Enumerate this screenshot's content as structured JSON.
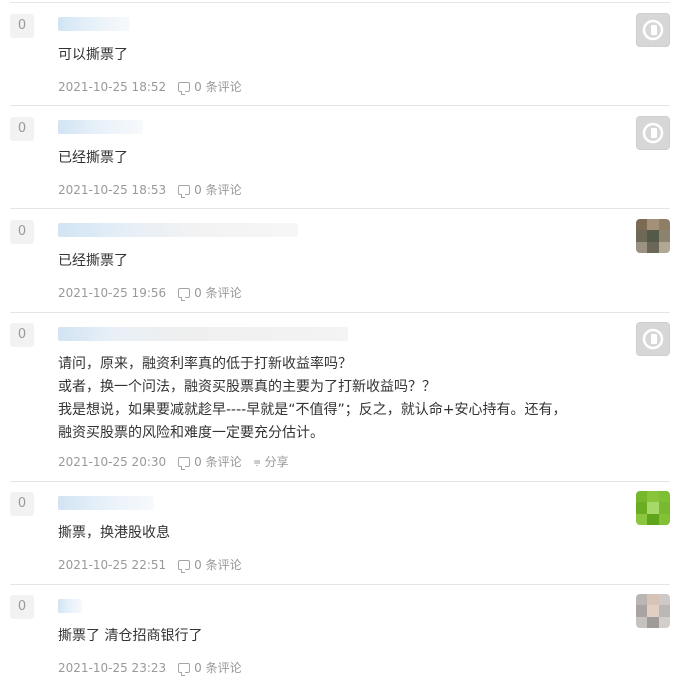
{
  "comments": [
    {
      "votes": "0",
      "text": [
        "可以撕票了"
      ],
      "time": "2021-10-25 18:52",
      "comments_label": "0 条评论",
      "avatar": "default-avatar-icon"
    },
    {
      "votes": "0",
      "text": [
        "已经撕票了"
      ],
      "time": "2021-10-25 18:53",
      "comments_label": "0 条评论",
      "avatar": "default-avatar-icon"
    },
    {
      "votes": "0",
      "text": [
        "已经撕票了"
      ],
      "time": "2021-10-25 19:56",
      "comments_label": "0 条评论",
      "avatar": "pixelated-avatar-brown"
    },
    {
      "votes": "0",
      "text": [
        "请问，原来，融资利率真的低于打新收益率吗？",
        "或者，换一个问法，融资买股票真的主要为了打新收益吗？？",
        "我是想说，如果要减就趁早----早就是“不值得”；反之，就认命+安心持有。还有，",
        "融资买股票的风险和难度一定要充分估计。"
      ],
      "time": "2021-10-25 20:30",
      "comments_label": "0 条评论",
      "share_label": "分享",
      "avatar": "default-avatar-icon"
    },
    {
      "votes": "0",
      "text": [
        "撕票，换港股收息"
      ],
      "time": "2021-10-25 22:51",
      "comments_label": "0 条评论",
      "avatar": "pixelated-avatar-green"
    },
    {
      "votes": "0",
      "text": [
        "撕票了 清仓招商银行了"
      ],
      "time": "2021-10-25 23:23",
      "comments_label": "0 条评论",
      "avatar": "pixelated-avatar-gray"
    }
  ]
}
